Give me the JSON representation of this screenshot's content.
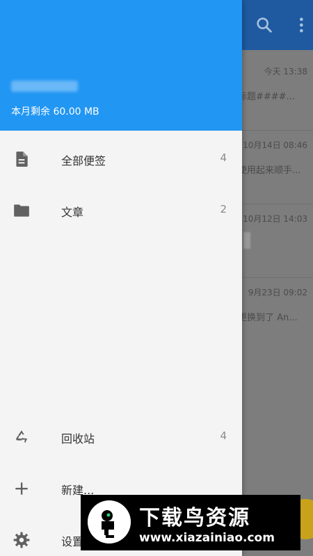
{
  "drawer": {
    "quota_text": "本月剩余 60.00 MB",
    "items": [
      {
        "icon": "document-icon",
        "label": "全部便签",
        "count": "4"
      },
      {
        "icon": "folder-icon",
        "label": "文章",
        "count": "2"
      }
    ],
    "bottom_items": [
      {
        "icon": "recycle-icon",
        "label": "回收站",
        "count": "4"
      },
      {
        "icon": "plus-icon",
        "label": "新建..."
      },
      {
        "icon": "gear-icon",
        "label": "设置"
      }
    ]
  },
  "background_list": {
    "notes": [
      {
        "time": "今天 13:38",
        "preview": "标题####..."
      },
      {
        "time": "10月14日 08:46",
        "preview": "使用起来顺手..."
      },
      {
        "time": "10月12日 14:03",
        "preview": ""
      },
      {
        "time": "9月23日 09:02",
        "preview": "更换到了 An..."
      }
    ]
  },
  "watermark": {
    "title": "下载鸟资源",
    "url": "www.xiazainiao.com"
  },
  "colors": {
    "header_blue": "#2196f3",
    "toolbar_dim": "#1f5aa0",
    "drawer_bg": "#f4f4f4"
  }
}
